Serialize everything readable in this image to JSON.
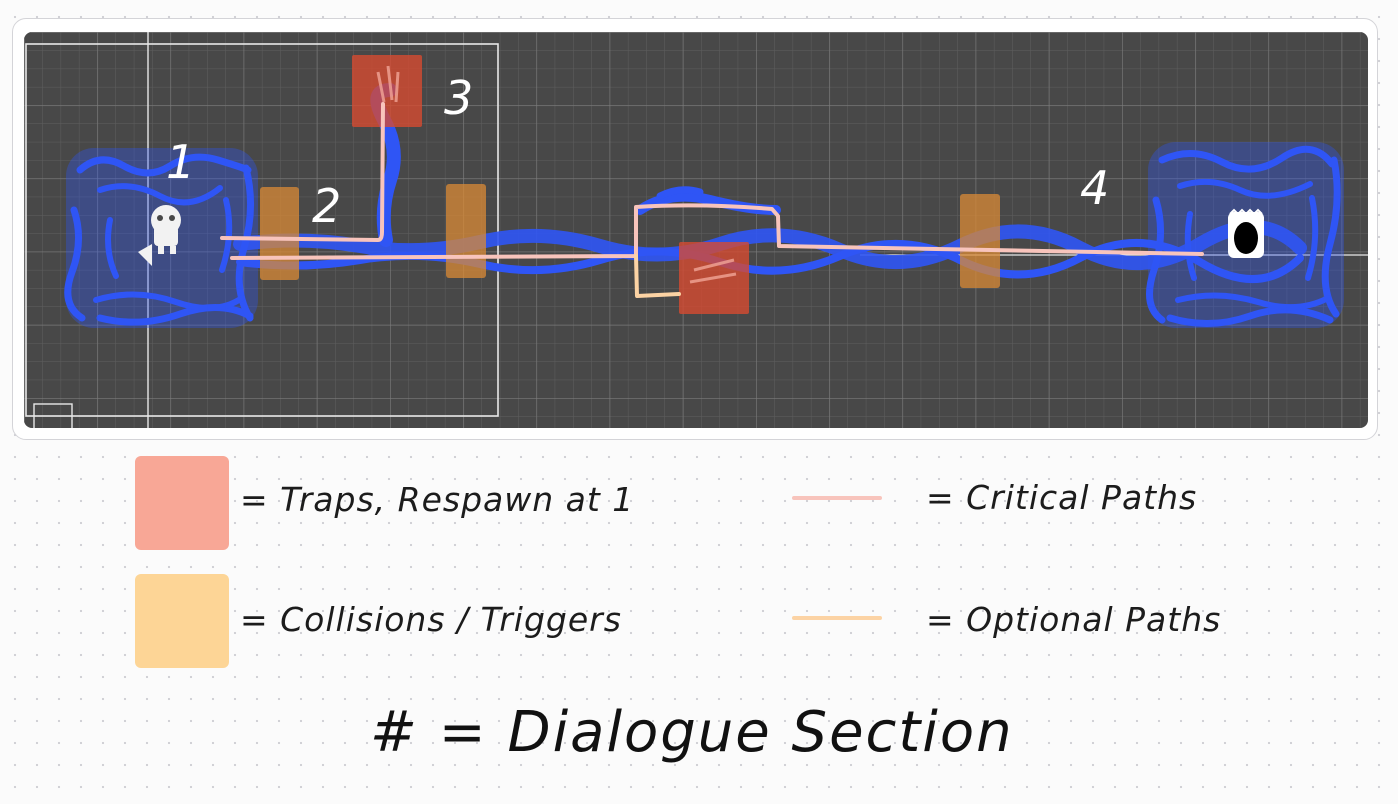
{
  "map": {
    "labels": [
      "1",
      "2",
      "3",
      "4"
    ]
  },
  "legend": {
    "traps": {
      "text": "= Traps, Respawn at 1",
      "color": "#f8a796"
    },
    "collisions": {
      "text": "= Collisions / Triggers",
      "color": "#fdd596"
    },
    "critical": {
      "text": "= Critical Paths",
      "color": "#f8c4bc"
    },
    "optional": {
      "text": "= Optional Paths",
      "color": "#fcd3a4"
    }
  },
  "footer": {
    "text": "# = Dialogue Section"
  },
  "colors": {
    "grid_background": "#484848",
    "flow_blue": "#2f55f5",
    "trap_red": "#d94a30",
    "trigger_orange": "#d98a35"
  }
}
